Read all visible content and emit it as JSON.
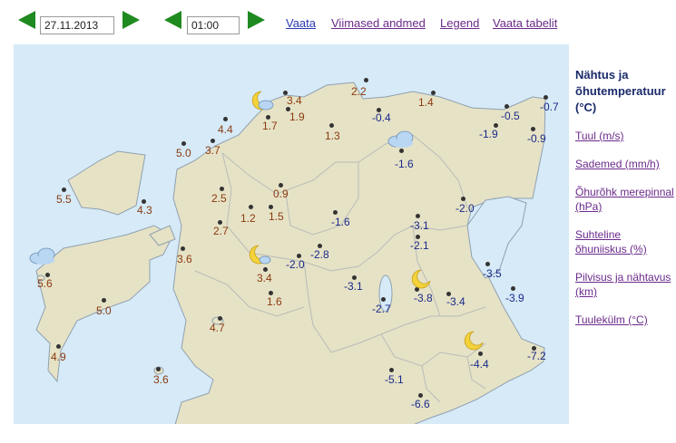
{
  "toolbar": {
    "date_value": "27.11.2013",
    "time_value": "01:00",
    "links": [
      "Vaata",
      "Viimased andmed",
      "Legend",
      "Vaata tabelit"
    ]
  },
  "legend": {
    "title": "Nähtus ja õhutemperatuur (°C)",
    "items": [
      "Tuul (m/s)",
      "Sademed (mm/h)",
      "Õhurõhk merepinnal (hPa)",
      "Suhteline õhuniiskus (%)",
      "Pilvisus ja nähtavus (km)",
      "Tuulekülm (°C)"
    ]
  },
  "stations": [
    {
      "temp": "3.4",
      "kind": "warm"
    },
    {
      "temp": "2.2",
      "kind": "warm"
    },
    {
      "temp": "1.4",
      "kind": "warm"
    },
    {
      "temp": "-0.5",
      "kind": "cold"
    },
    {
      "temp": "-0.7",
      "kind": "cold"
    },
    {
      "temp": "1.9",
      "kind": "warm"
    },
    {
      "temp": "-0.4",
      "kind": "cold"
    },
    {
      "temp": "4.4",
      "kind": "warm"
    },
    {
      "temp": "1.7",
      "kind": "warm"
    },
    {
      "temp": "1.3",
      "kind": "warm"
    },
    {
      "temp": "-1.9",
      "kind": "cold"
    },
    {
      "temp": "-0.9",
      "kind": "cold"
    },
    {
      "temp": "5.0",
      "kind": "warm"
    },
    {
      "temp": "3.7",
      "kind": "warm"
    },
    {
      "temp": "-1.6",
      "kind": "cold"
    },
    {
      "temp": "5.5",
      "kind": "warm"
    },
    {
      "temp": "4.3",
      "kind": "warm"
    },
    {
      "temp": "2.5",
      "kind": "warm"
    },
    {
      "temp": "0.9",
      "kind": "warm"
    },
    {
      "temp": "-2.0",
      "kind": "cold"
    },
    {
      "temp": "1.2",
      "kind": "warm"
    },
    {
      "temp": "1.5",
      "kind": "warm"
    },
    {
      "temp": "-1.6",
      "kind": "cold"
    },
    {
      "temp": "-3.1",
      "kind": "cold"
    },
    {
      "temp": "2.7",
      "kind": "warm"
    },
    {
      "temp": "-2.1",
      "kind": "cold"
    },
    {
      "temp": "3.6",
      "kind": "warm"
    },
    {
      "temp": "-2.8",
      "kind": "cold"
    },
    {
      "temp": "-2.0",
      "kind": "cold"
    },
    {
      "temp": "-3.5",
      "kind": "cold"
    },
    {
      "temp": "5.6",
      "kind": "warm"
    },
    {
      "temp": "3.4",
      "kind": "warm"
    },
    {
      "temp": "-3.1",
      "kind": "cold"
    },
    {
      "temp": "-3.8",
      "kind": "cold"
    },
    {
      "temp": "-3.4",
      "kind": "cold"
    },
    {
      "temp": "-3.9",
      "kind": "cold"
    },
    {
      "temp": "5.0",
      "kind": "warm"
    },
    {
      "temp": "1.6",
      "kind": "warm"
    },
    {
      "temp": "-2.7",
      "kind": "cold"
    },
    {
      "temp": "4.7",
      "kind": "warm"
    },
    {
      "temp": "4.9",
      "kind": "warm"
    },
    {
      "temp": "-4.4",
      "kind": "cold"
    },
    {
      "temp": "-7.2",
      "kind": "cold"
    },
    {
      "temp": "3.6",
      "kind": "warm"
    },
    {
      "temp": "-5.1",
      "kind": "cold"
    },
    {
      "temp": "-6.6",
      "kind": "cold"
    }
  ],
  "weather_icons": [
    {
      "icon": "moon-cloud-icon"
    },
    {
      "icon": "cloud-icon"
    },
    {
      "icon": "cloud-icon"
    },
    {
      "icon": "moon-cloud-icon"
    },
    {
      "icon": "moon-icon"
    },
    {
      "icon": "moon-icon"
    }
  ],
  "colors": {
    "warm_temp": "#8b3a10",
    "cold_temp": "#1a2a8a",
    "land": "#e6e2c6",
    "sea": "#d6eaf7",
    "arrow": "#1f8a1f"
  }
}
